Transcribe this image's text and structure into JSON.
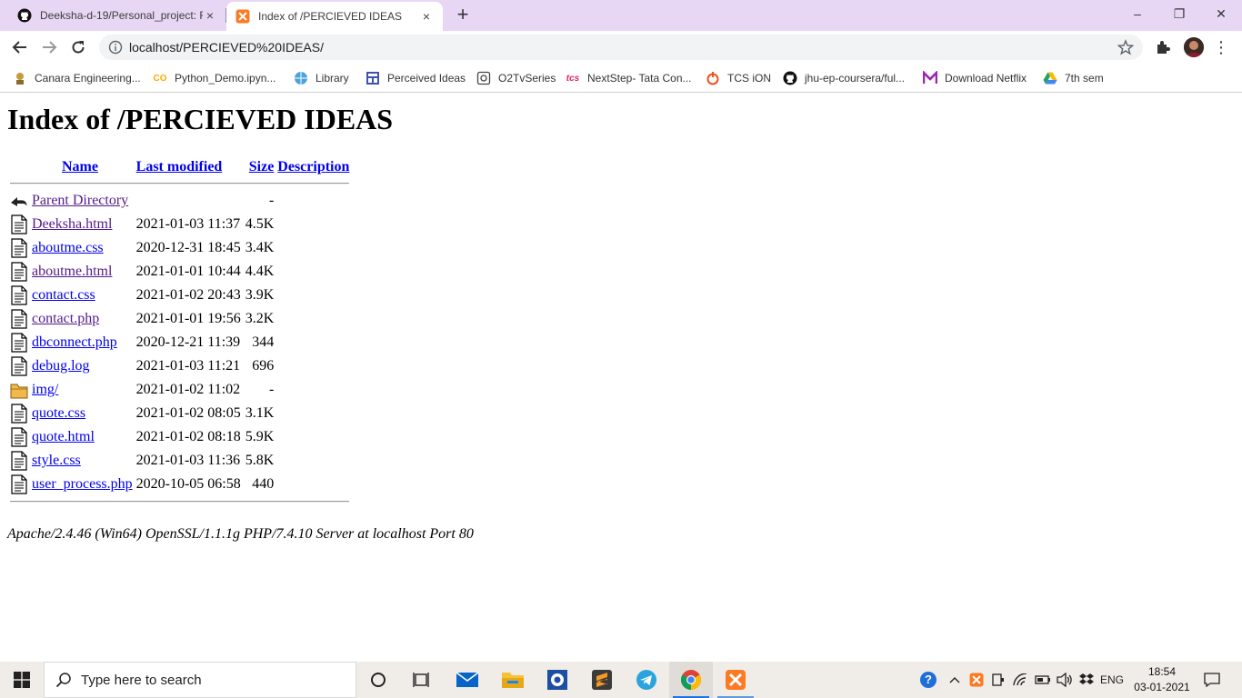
{
  "browser": {
    "tabs": [
      {
        "title": "Deeksha-d-19/Personal_project: F",
        "close": "×"
      },
      {
        "title": "Index of /PERCIEVED IDEAS",
        "close": "×"
      }
    ],
    "new_tab": "+",
    "window_controls": {
      "minimize": "–",
      "restore": "❐",
      "close": "✕"
    },
    "url": "localhost/PERCIEVED%20IDEAS/",
    "menu": "⋮",
    "bookmarks": [
      {
        "label": "Canara Engineering...",
        "icon": "canara-icon",
        "color": "#c79a3c"
      },
      {
        "label": "Python_Demo.ipyn...",
        "icon": "colab-icon",
        "color": "#f9ab00"
      },
      {
        "label": "Library",
        "icon": "globe-icon",
        "color": "#1a73e8"
      },
      {
        "label": "Perceived Ideas",
        "icon": "perceived-ideas-icon",
        "color": "#3f51b5"
      },
      {
        "label": "O2TvSeries",
        "icon": "o2tv-icon",
        "color": "#444444"
      },
      {
        "label": "NextStep- Tata Con...",
        "icon": "tcs-icon",
        "color": "#e0245e"
      },
      {
        "label": "TCS iON",
        "icon": "tcs-ion-icon",
        "color": "#e8541c"
      },
      {
        "label": "jhu-ep-coursera/ful...",
        "icon": "github-icon",
        "color": "#111111"
      },
      {
        "label": "Download Netflix",
        "icon": "netflix-m-icon",
        "color": "#9c27b0"
      },
      {
        "label": "7th sem",
        "icon": "google-drive-icon",
        "color": "#1fa463"
      }
    ]
  },
  "page": {
    "heading": "Index of /PERCIEVED IDEAS",
    "columns": {
      "name": "Name",
      "modified": "Last modified",
      "size": "Size",
      "description": "Description"
    },
    "rows": [
      {
        "name": "Parent Directory",
        "modified": "",
        "size": "-",
        "icon": "back-arrow-icon",
        "visited": true
      },
      {
        "name": "Deeksha.html",
        "modified": "2021-01-03 11:37",
        "size": "4.5K",
        "icon": "text-file-icon",
        "visited": true
      },
      {
        "name": "aboutme.css",
        "modified": "2020-12-31 18:45",
        "size": "3.4K",
        "icon": "text-file-icon",
        "visited": false
      },
      {
        "name": "aboutme.html",
        "modified": "2021-01-01 10:44",
        "size": "4.4K",
        "icon": "text-file-icon",
        "visited": true
      },
      {
        "name": "contact.css",
        "modified": "2021-01-02 20:43",
        "size": "3.9K",
        "icon": "text-file-icon",
        "visited": false
      },
      {
        "name": "contact.php",
        "modified": "2021-01-01 19:56",
        "size": "3.2K",
        "icon": "text-file-icon",
        "visited": true
      },
      {
        "name": "dbconnect.php",
        "modified": "2020-12-21 11:39",
        "size": "344",
        "icon": "text-file-icon",
        "visited": false
      },
      {
        "name": "debug.log",
        "modified": "2021-01-03 11:21",
        "size": "696",
        "icon": "text-file-icon",
        "visited": false
      },
      {
        "name": "img/",
        "modified": "2021-01-02 11:02",
        "size": "-",
        "icon": "folder-icon",
        "visited": false
      },
      {
        "name": "quote.css",
        "modified": "2021-01-02 08:05",
        "size": "3.1K",
        "icon": "text-file-icon",
        "visited": false
      },
      {
        "name": "quote.html",
        "modified": "2021-01-02 08:18",
        "size": "5.9K",
        "icon": "text-file-icon",
        "visited": false
      },
      {
        "name": "style.css",
        "modified": "2021-01-03 11:36",
        "size": "5.8K",
        "icon": "text-file-icon",
        "visited": false
      },
      {
        "name": "user_process.php",
        "modified": "2020-10-05 06:58",
        "size": "440",
        "icon": "text-file-icon",
        "visited": false
      }
    ],
    "footer": "Apache/2.4.46 (Win64) OpenSSL/1.1.1g PHP/7.4.10 Server at localhost Port 80"
  },
  "taskbar": {
    "search_placeholder": "Type here to search",
    "language": "ENG",
    "time": "18:54",
    "date": "03-01-2021",
    "help": "?"
  },
  "colors": {
    "tabstrip": "#e8d7f4",
    "link": "#0000ee",
    "visited_link": "#551a8b",
    "taskbar": "#f0ede9"
  }
}
